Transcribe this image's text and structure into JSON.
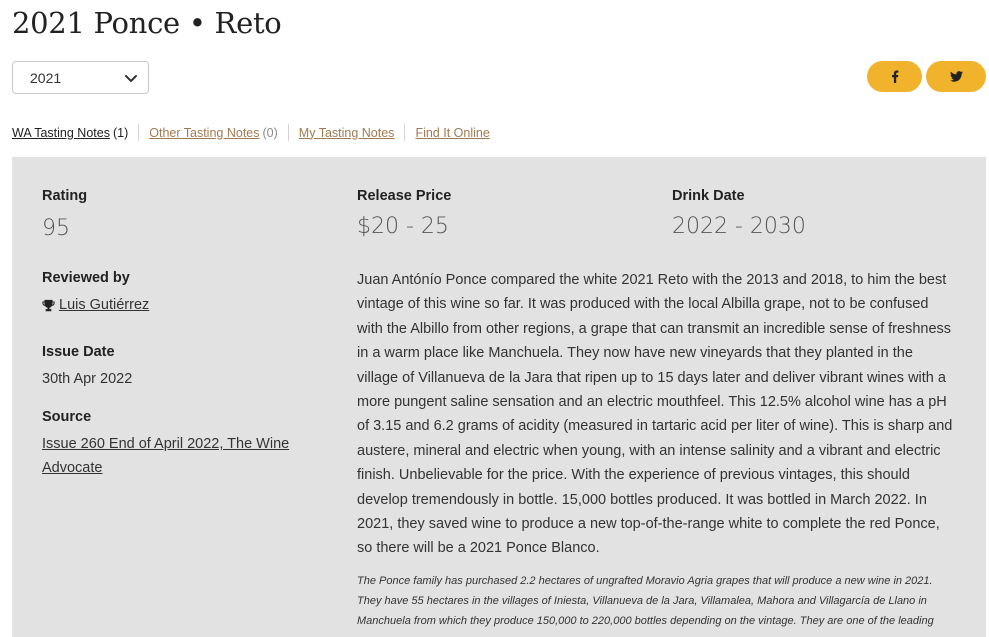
{
  "page": {
    "title": "2021 Ponce • Reto"
  },
  "vintage_select": {
    "selected": "2021"
  },
  "share": {
    "facebook": "f",
    "twitter": "twitter"
  },
  "tabs": [
    {
      "label": "WA Tasting Notes",
      "count": "(1)",
      "active": true
    },
    {
      "label": "Other Tasting Notes",
      "count": "(0)",
      "active": false
    },
    {
      "label": "My Tasting Notes",
      "count": "",
      "active": false
    },
    {
      "label": "Find It Online",
      "count": "",
      "active": false
    }
  ],
  "details": {
    "rating_label": "Rating",
    "rating": "95",
    "release_price_label": "Release Price",
    "release_price": "$20 - 25",
    "drink_date_label": "Drink Date",
    "drink_date": "2022 - 2030",
    "reviewed_by_label": "Reviewed by",
    "reviewer": "Luis Gutiérrez",
    "issue_date_label": "Issue Date",
    "issue_date": "30th Apr 2022",
    "source_label": "Source",
    "source": "Issue 260 End of April 2022, The Wine Advocate"
  },
  "review": {
    "text": "Juan Antónío Ponce compared the white 2021 Reto with the 2013 and 2018, to him the best vintage of this wine so far. It was produced with the local Albilla grape, not to be confused with the Albillo from other regions, a grape that can transmit an incredible sense of freshness in a warm place like Manchuela. They now have new vineyards that they planted in the village of Villanueva de la Jara that ripen up to 15 days later and deliver vibrant wines with a more pungent saline sensation and an electric mouthfeel. This 12.5% alcohol wine has a pH of 3.15 and 6.2 grams of acidity (measured in tartaric acid per liter of wine). This is sharp and austere, mineral and electric when young, with an intense salinity and a vibrant and electric finish. Unbelievable for the price. With the experience of previous vintages, this should develop tremendously in bottle. 15,000 bottles produced. It was bottled in March 2022. In 2021, they saved wine to produce a new top-of-the-range white to complete the red Ponce, so there will be a 2021 Ponce Blanco.",
    "note": "The Ponce family has purchased 2.2 hectares of ungrafted Moravio Agria grapes that will produce a new wine in 2021. They have 55 hectares in the villages of Iniesta, Villanueva de la Jara, Villamalea, Mahora and Villagarcía de Llano in Manchuela from which they produce 150,000 to 220,000 bottles depending on the vintage. They are one of the leading"
  },
  "colors": {
    "accent": "#f2b32c",
    "panel": "#e2e2e2",
    "link_muted": "#a07a52"
  }
}
